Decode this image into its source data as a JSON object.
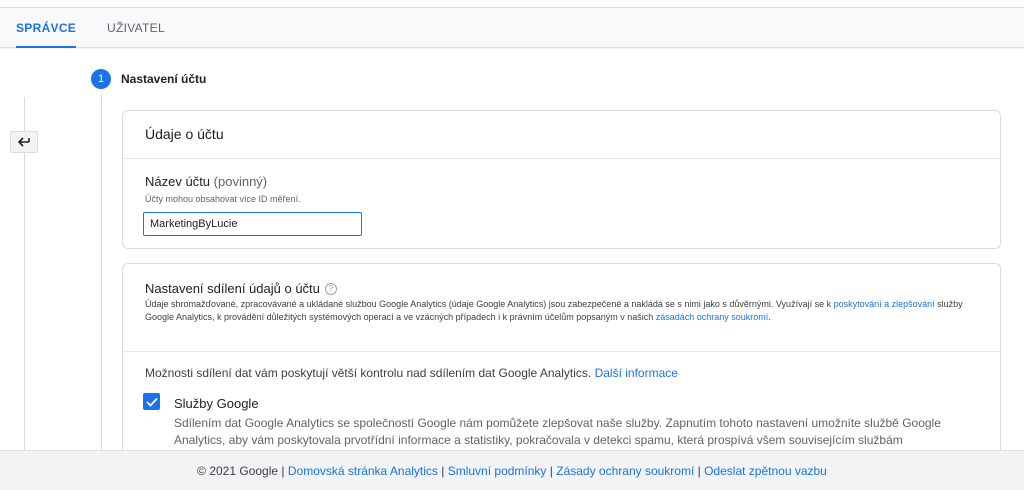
{
  "tabs": [
    {
      "label": "SPRÁVCE",
      "active": true
    },
    {
      "label": "UŽIVATEL",
      "active": false
    }
  ],
  "step": {
    "number": "1",
    "title": "Nastavení účtu"
  },
  "account_card": {
    "title": "Údaje o účtu",
    "field_label": "Název účtu",
    "field_optional": "(povinný)",
    "field_help": "Účty mohou obsahovat více ID měření.",
    "field_value": "MarketingByLucie"
  },
  "sharing_card": {
    "title": "Nastavení sdílení údajů o účtu",
    "help_icon": "?",
    "desc_part1": "Údaje shromažďované, zpracovávané a ukládané službou Google Analytics (údaje Google Analytics) jsou zabezpečené a nakládá se s nimi jako s důvěrnými. Využívají se k ",
    "desc_link1": "poskytování a zlepšování",
    "desc_part2": " služby Google Analytics, k provádění důležitých systémových operací a ve vzácných případech i k právním účelům popsaným v našich ",
    "desc_link2": "zásadách ochrany soukromí",
    "desc_part3": ".",
    "more_text": "Možnosti sdílení dat vám poskytují větší kontrolu nad sdílením dat Google Analytics. ",
    "more_link": "Další informace",
    "google_services": {
      "title": "Služby Google",
      "desc": "Sdílením dat Google Analytics se společností Google nám pomůžete zlepšovat naše služby. Zapnutím tohoto nastavení umožníte službě Google Analytics, aby vám poskytovala prvotřídní informace a statistiky, pokračovala v detekci spamu, která prospívá všem souvisejícím službám",
      "checked": true
    }
  },
  "footer": {
    "copyright": "© 2021 Google",
    "sep": " | ",
    "links": [
      "Domovská stránka Analytics",
      "Smluvní podmínky",
      "Zásady ochrany soukromí",
      "Odeslat zpětnou vazbu"
    ]
  },
  "icons": {
    "back": "arrow-back-icon",
    "check": "check-icon",
    "help": "help-circle-icon"
  },
  "colors": {
    "accent": "#1a73e8",
    "text": "#202124",
    "muted": "#5f6368"
  }
}
